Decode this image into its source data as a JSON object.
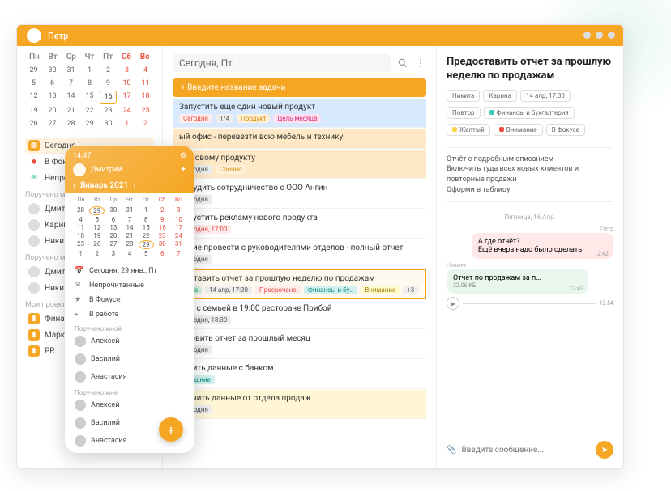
{
  "user": "Петр",
  "weekdays": [
    "Пн",
    "Вт",
    "Ср",
    "Чт",
    "Пт",
    "Сб",
    "Вс"
  ],
  "main_cal_rows": [
    [
      "29",
      "30",
      "31",
      "1",
      "2",
      "3",
      "4"
    ],
    [
      "5",
      "6",
      "7",
      "8",
      "9",
      "10",
      "11"
    ],
    [
      "12",
      "13",
      "14",
      "15",
      "16",
      "17",
      "18"
    ],
    [
      "19",
      "20",
      "21",
      "22",
      "23",
      "24",
      "25"
    ],
    [
      "26",
      "27",
      "28",
      "29",
      "30",
      "1",
      "2"
    ]
  ],
  "main_today": "16",
  "sidebar": {
    "items": [
      {
        "icon": "calendar",
        "label": "Сегодня",
        "active": true
      },
      {
        "icon": "bookmark",
        "label": "В Фокусе"
      },
      {
        "icon": "inbox",
        "label": "Непрочитанные"
      }
    ],
    "sent_label": "Поручено мной",
    "sent": [
      "Дмитрий",
      "Карина",
      "Никита"
    ],
    "recv_label": "Поручено мне",
    "recv": [
      "Дмитрий",
      "Никита"
    ],
    "proj_label": "Мои проекты",
    "projects": [
      "Финансы",
      "Маркетинг",
      "PR"
    ]
  },
  "center": {
    "title": "Сегодня, Пт",
    "add_placeholder": "Введите название задачи",
    "tasks": [
      {
        "style": "blue",
        "title": "Запустить еще один новый продукт",
        "tags": [
          {
            "t": "Сегодня",
            "c": "red"
          },
          {
            "t": "1/4"
          },
          {
            "t": "Продукт",
            "c": "orange"
          },
          {
            "t": "Цель месяца",
            "c": "pink"
          }
        ]
      },
      {
        "style": "peach",
        "title": "ый офис - перевезти всю мебель и технику",
        "tags": []
      },
      {
        "style": "peach",
        "title": "по новому продукту",
        "tags": [
          {
            "t": "Сегодня"
          },
          {
            "t": "Срочно",
            "c": "orange"
          }
        ]
      },
      {
        "title": "Обсудить сотрудничество с ООО Ангин",
        "tags": [
          {
            "t": "Сегодня"
          }
        ]
      },
      {
        "title": "Запустить рекламу нового продукта",
        "tags": [
          {
            "t": "Сегодня, 17:00",
            "c": "red"
          }
        ]
      },
      {
        "title": "рание провести с руководителями отделов - полный отчет",
        "tags": [
          {
            "t": "Сегодня"
          }
        ]
      },
      {
        "style": "sel",
        "title": "доставить отчет за прошлую неделю по продажам",
        "tags": [
          {
            "t": "кита",
            "c": "green"
          },
          {
            "t": "14 апр, 17:30"
          },
          {
            "t": "Просрочено",
            "c": "red"
          },
          {
            "t": "Финансы и бу…",
            "c": "teal"
          },
          {
            "t": "Внимание",
            "c": "yellow"
          },
          {
            "t": "+3",
            "c": "gray"
          }
        ]
      },
      {
        "title": "жин с семьей в 19:00 ресторане Прибой",
        "tags": [
          {
            "t": "Сегодня, 18:30"
          }
        ]
      },
      {
        "title": "готовить отчет за прошлый месяц",
        "tags": [
          {
            "t": "Сегодня"
          }
        ]
      },
      {
        "title": "верить данные с банком",
        "tags": [
          {
            "t": "Внешние",
            "c": "teal"
          }
        ]
      },
      {
        "style": "ylw",
        "title": "олучить данные от отдела продаж",
        "tags": [
          {
            "t": "Сегодня"
          }
        ]
      }
    ]
  },
  "detail": {
    "title": "Предоставить отчет за прошлую неделю по продажам",
    "chips1": [
      {
        "t": "Никита"
      },
      {
        "t": "Карина"
      },
      {
        "t": "14 апр, 17:30"
      }
    ],
    "chips2": [
      {
        "t": "Повтор"
      },
      {
        "t": "Финансы и бухгалтерия",
        "dot": "t"
      }
    ],
    "chips3": [
      {
        "t": "Желтый",
        "dot": "y"
      },
      {
        "t": "Внимание",
        "dot": "r"
      },
      {
        "t": "В Фокусе"
      }
    ],
    "note_lines": [
      "Отчёт с подробным описанием",
      "Включить туда всех новых клиентов и повторные продажи",
      "Оформи в таблицу"
    ],
    "chat_date": "Пятница, 16 Апр.",
    "author_out": "Петр",
    "bubble_out1": "А где отчёт?",
    "bubble_out2": "Ещё вчера надо было сделать",
    "time_out": "12:42",
    "author_in": "Никита",
    "attach_name": "Отчет по продажам за п…",
    "attach_size": "32.06 КБ",
    "time_in": "12:43",
    "time_voice": "12:54",
    "msg_placeholder": "Введите сообщение..."
  },
  "mobile": {
    "user": "Дмитрий",
    "time": "14:47",
    "month": "Январь 2021",
    "cal_rows": [
      [
        "28",
        "29",
        "30",
        "31",
        "1",
        "2",
        "3"
      ],
      [
        "4",
        "5",
        "6",
        "7",
        "8",
        "9",
        "10"
      ],
      [
        "11",
        "12",
        "13",
        "14",
        "15",
        "16",
        "17"
      ],
      [
        "18",
        "19",
        "20",
        "21",
        "22",
        "23",
        "24"
      ],
      [
        "25",
        "26",
        "27",
        "28",
        "29",
        "30",
        "31"
      ],
      [
        "1",
        "2",
        "3",
        "4",
        "5",
        "6",
        "7"
      ]
    ],
    "today": "29",
    "today_label": "Сегодня: 29 янв., Пт",
    "items": [
      {
        "icon": "✉",
        "label": "Непрочитанные"
      },
      {
        "icon": "★",
        "label": "В Фокусе"
      },
      {
        "icon": "▸",
        "label": "В работе"
      }
    ],
    "sent_label": "Поручено мной",
    "sent": [
      "Алексей",
      "Василий",
      "Анастасия"
    ],
    "recv_label": "Поручено мне",
    "recv": [
      "Алексей",
      "Василий",
      "Анастасия"
    ]
  }
}
